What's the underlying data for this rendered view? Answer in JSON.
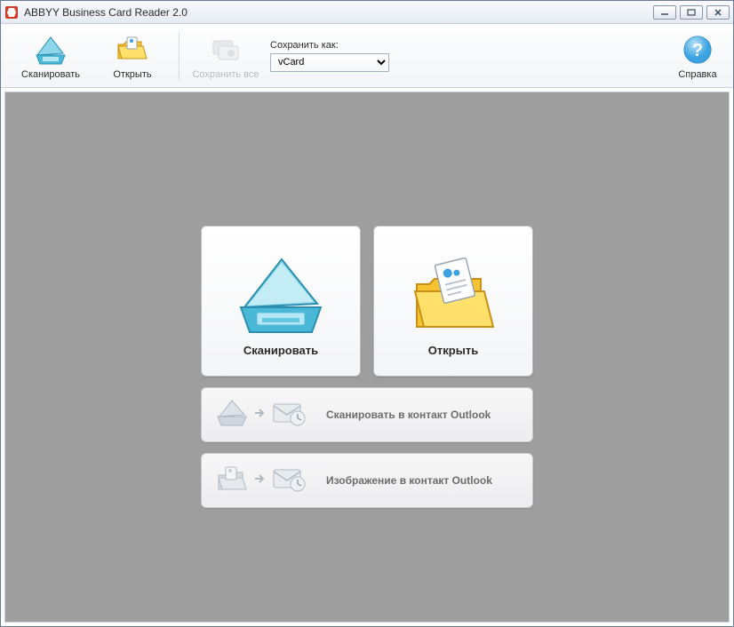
{
  "window": {
    "title": "ABBYY Business Card Reader 2.0"
  },
  "toolbar": {
    "scan_label": "Сканировать",
    "open_label": "Открыть",
    "save_all_label": "Сохранить все",
    "save_as_label": "Сохранить как:",
    "save_as_value": "vCard",
    "help_label": "Справка"
  },
  "main": {
    "scan_label": "Сканировать",
    "open_label": "Открыть",
    "scan_outlook_label": "Сканировать в контакт Outlook",
    "image_outlook_label": "Изображение в контакт Outlook"
  }
}
